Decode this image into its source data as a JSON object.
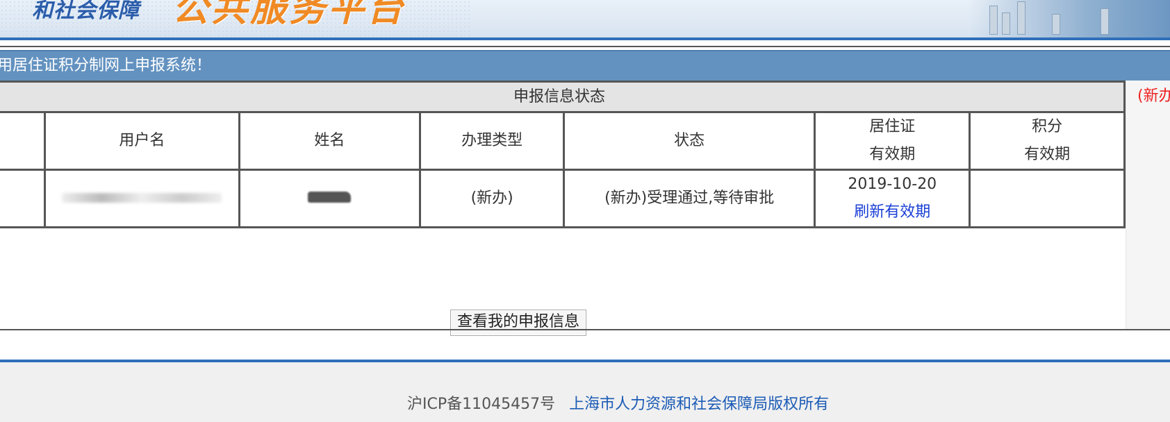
{
  "header": {
    "logo_small": "和社会保障",
    "logo_big": "公共服务平台"
  },
  "welcome_text": "用居住证积分制网上申报系统！",
  "status_table": {
    "title": "申报信息状态",
    "headers": {
      "username": "用户名",
      "name": "姓名",
      "type": "办理类型",
      "status": "状态",
      "permit_line1": "居住证",
      "permit_line2": "有效期",
      "points_line1": "积分",
      "points_line2": "有效期"
    },
    "row": {
      "type": "(新办)",
      "status": "(新办)受理通过,等待审批",
      "permit_date": "2019-10-20",
      "refresh_link": "刷新有效期",
      "points_validity": ""
    }
  },
  "view_button": "查看我的申报信息",
  "right_note": "(新办",
  "footer": {
    "icp": "沪ICP备11045457号",
    "copyright": "上海市人力资源和社会保障局版权所有"
  },
  "colors": {
    "header_accent": "#2f6fba",
    "welcome_bar": "#6392c0",
    "logo_orange": "#f08a24",
    "link_blue": "#1a3fd6",
    "note_red": "#ee2222"
  }
}
